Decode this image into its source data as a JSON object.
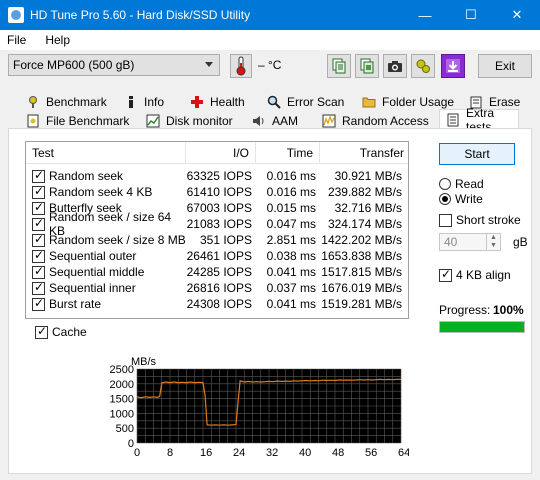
{
  "window": {
    "title": "HD Tune Pro 5.60 - Hard Disk/SSD Utility",
    "minimize": "—",
    "maximize": "☐",
    "close": "✕"
  },
  "menu": {
    "file": "File",
    "help": "Help"
  },
  "toolbar": {
    "drive": "Force MP600 (500 gB)",
    "temperature": "– °C",
    "exit": "Exit",
    "icons": [
      "copy-text-icon",
      "copy-info-icon",
      "screenshot-icon",
      "options-icon",
      "save-icon"
    ]
  },
  "tabs_row1": [
    "Benchmark",
    "Info",
    "Health",
    "Error Scan",
    "Folder Usage",
    "Erase"
  ],
  "tabs_row2": [
    "File Benchmark",
    "Disk monitor",
    "AAM",
    "Random Access",
    "Extra tests"
  ],
  "table": {
    "headers": [
      "Test",
      "I/O",
      "Time",
      "Transfer"
    ],
    "rows": [
      {
        "test": "Random seek",
        "io": "63325 IOPS",
        "time": "0.016 ms",
        "transfer": "30.921 MB/s"
      },
      {
        "test": "Random seek 4 KB",
        "io": "61410 IOPS",
        "time": "0.016 ms",
        "transfer": "239.882 MB/s"
      },
      {
        "test": "Butterfly seek",
        "io": "67003 IOPS",
        "time": "0.015 ms",
        "transfer": "32.716 MB/s"
      },
      {
        "test": "Random seek / size 64 KB",
        "io": "21083 IOPS",
        "time": "0.047 ms",
        "transfer": "324.174 MB/s"
      },
      {
        "test": "Random seek / size 8 MB",
        "io": "351 IOPS",
        "time": "2.851 ms",
        "transfer": "1422.202 MB/s"
      },
      {
        "test": "Sequential outer",
        "io": "26461 IOPS",
        "time": "0.038 ms",
        "transfer": "1653.838 MB/s"
      },
      {
        "test": "Sequential middle",
        "io": "24285 IOPS",
        "time": "0.041 ms",
        "transfer": "1517.815 MB/s"
      },
      {
        "test": "Sequential inner",
        "io": "26816 IOPS",
        "time": "0.037 ms",
        "transfer": "1676.019 MB/s"
      },
      {
        "test": "Burst rate",
        "io": "24308 IOPS",
        "time": "0.041 ms",
        "transfer": "1519.281 MB/s"
      }
    ]
  },
  "controls": {
    "start": "Start",
    "read": "Read",
    "write": "Write",
    "mode_selected": "Write",
    "short_stroke": "Short stroke",
    "short_stroke_checked": false,
    "stroke_value": "40",
    "stroke_unit": "gB",
    "align": "4 KB align",
    "align_checked": true,
    "progress_label": "Progress:",
    "progress_text": "100%",
    "progress": 1.0
  },
  "cache": {
    "label": "Cache",
    "checked": true
  },
  "chart_data": {
    "type": "line",
    "ylabel": "MB/s",
    "xunit": "MB",
    "xlim": [
      0,
      64
    ],
    "ylim": [
      0,
      2500
    ],
    "yticks": [
      0,
      500,
      1000,
      1500,
      2000,
      2500
    ],
    "xticks": [
      "0",
      "8",
      "16",
      "24",
      "32",
      "40",
      "48",
      "56",
      "64MB"
    ],
    "background": "#000000",
    "grid": true,
    "grid_color": "#5a5a5a",
    "series": [
      {
        "color": "#e07a1f",
        "x": [
          0,
          1,
          2,
          3,
          4,
          5,
          5.5,
          6,
          7,
          8,
          9,
          10,
          11,
          12,
          13,
          14,
          15,
          16,
          16.5,
          17,
          18,
          19,
          20,
          21,
          22,
          23,
          24,
          24.5,
          25,
          26,
          27,
          28,
          29,
          30,
          31,
          32,
          33,
          34,
          35,
          36,
          37,
          38,
          39,
          40,
          41,
          42,
          43,
          44,
          45,
          46,
          47,
          48,
          49,
          50,
          51,
          52,
          53,
          54,
          55,
          56,
          57,
          58,
          59,
          60,
          61,
          62,
          63,
          64
        ],
        "y": [
          1560,
          1530,
          1560,
          1540,
          1560,
          1540,
          1580,
          2030,
          2060,
          2040,
          2060,
          2040,
          2050,
          2040,
          2060,
          2040,
          2050,
          2040,
          1600,
          610,
          600,
          610,
          600,
          610,
          600,
          610,
          620,
          1400,
          2100,
          2060,
          2080,
          2060,
          2070,
          2060,
          2070,
          2080,
          2070,
          2090,
          2080,
          2090,
          2080,
          2100,
          2090,
          2100,
          2110,
          2100,
          2110,
          2100,
          2120,
          2110,
          2120,
          2110,
          2130,
          2120,
          2130,
          2120,
          2130,
          2140,
          2130,
          2140,
          2130,
          2140,
          2150,
          2140,
          2150,
          2140,
          2150,
          2150
        ]
      }
    ]
  }
}
